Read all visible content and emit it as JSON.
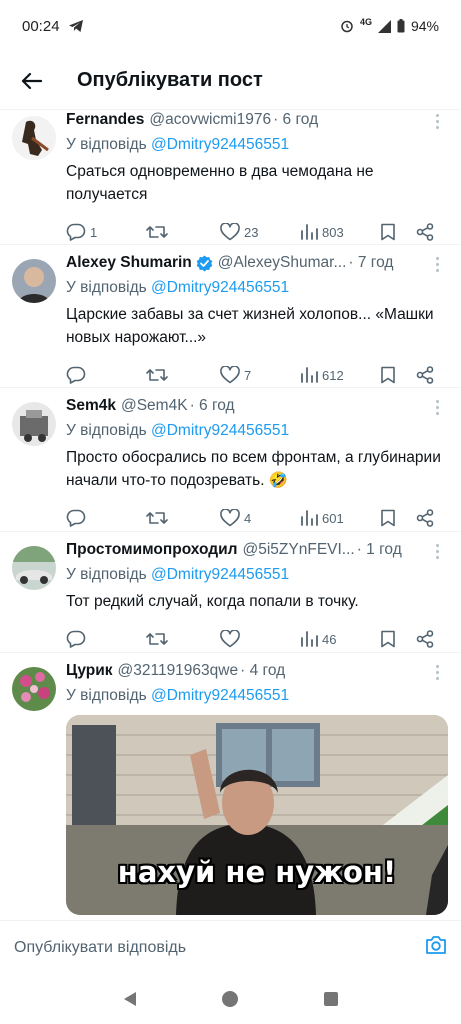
{
  "status_bar": {
    "time": "00:24",
    "network": "4G",
    "battery": "94%"
  },
  "header": {
    "title": "Опублікувати пост"
  },
  "tweets": [
    {
      "name": "Fernandes",
      "handle": "@acovwicmi1976",
      "time": "· 6 год",
      "reply_prefix": "У відповідь",
      "reply_mention": "@Dmitry924456551",
      "text": "Сраться одновременно в два чемодана не получается",
      "replies": "1",
      "retweets": "",
      "likes": "23",
      "views": "803"
    },
    {
      "name": "Alexey Shumarin",
      "handle": "@AlexeyShumar...",
      "time": "· 7 год",
      "verified": true,
      "reply_prefix": "У відповідь",
      "reply_mention": "@Dmitry924456551",
      "text": "Царские забавы за счет жизней холопов... «Машки новых нарожают...»",
      "replies": "",
      "retweets": "",
      "likes": "7",
      "views": "612"
    },
    {
      "name": "Sem4k",
      "handle": "@Sem4K",
      "time": "· 6 год",
      "reply_prefix": "У відповідь",
      "reply_mention": "@Dmitry924456551",
      "text": "Просто обосрались по всем фронтам, а глубинарии начали что-то подозревать. 🤣",
      "replies": "",
      "retweets": "",
      "likes": "4",
      "views": "601"
    },
    {
      "name": "Простомимопроходил",
      "handle": "@5i5ZYnFEVI...",
      "time": "· 1 год",
      "reply_prefix": "У відповідь",
      "reply_mention": "@Dmitry924456551",
      "text": "Тот редкий случай, когда попали в точку.",
      "replies": "",
      "retweets": "",
      "likes": "",
      "views": "46"
    },
    {
      "name": "Цурик",
      "handle": "@321191963qwe",
      "time": "· 4 год",
      "reply_prefix": "У відповідь",
      "reply_mention": "@Dmitry924456551",
      "media_caption": "нахуй не нужон!"
    }
  ],
  "reply_bar": {
    "placeholder": "Опублікувати відповідь"
  },
  "colors": {
    "accent": "#1d9bf0",
    "text": "#0f1419",
    "muted": "#536471",
    "divider": "#eff3f4"
  }
}
